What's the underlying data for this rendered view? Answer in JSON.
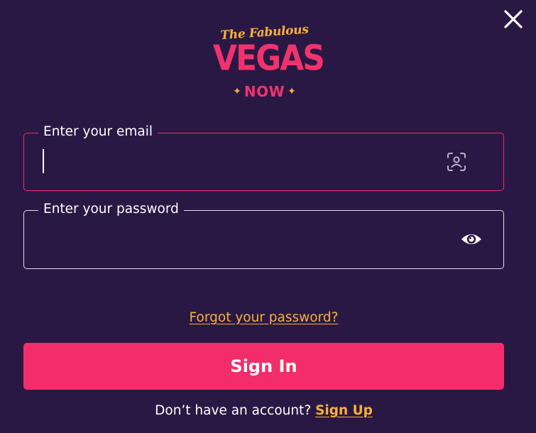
{
  "colors": {
    "background": "#2a1844",
    "accent_pink": "#f32d6c",
    "accent_gold": "#f6b23a",
    "text": "#ffffff"
  },
  "logo": {
    "tagline": "The Fabulous",
    "main": "VEGAS",
    "sub": "NOW",
    "star_glyph": "✦"
  },
  "close": {
    "icon": "close-icon"
  },
  "email": {
    "label": "Enter your email",
    "value": "",
    "placeholder": "",
    "icon": "face-scan-icon"
  },
  "password": {
    "label": "Enter your password",
    "value": "",
    "placeholder": "",
    "icon": "eye-icon"
  },
  "forgot_link": "Forgot your password?",
  "signin_button": "Sign In",
  "footer": {
    "prompt": "Don’t have an account?",
    "signup_link": "Sign Up"
  }
}
